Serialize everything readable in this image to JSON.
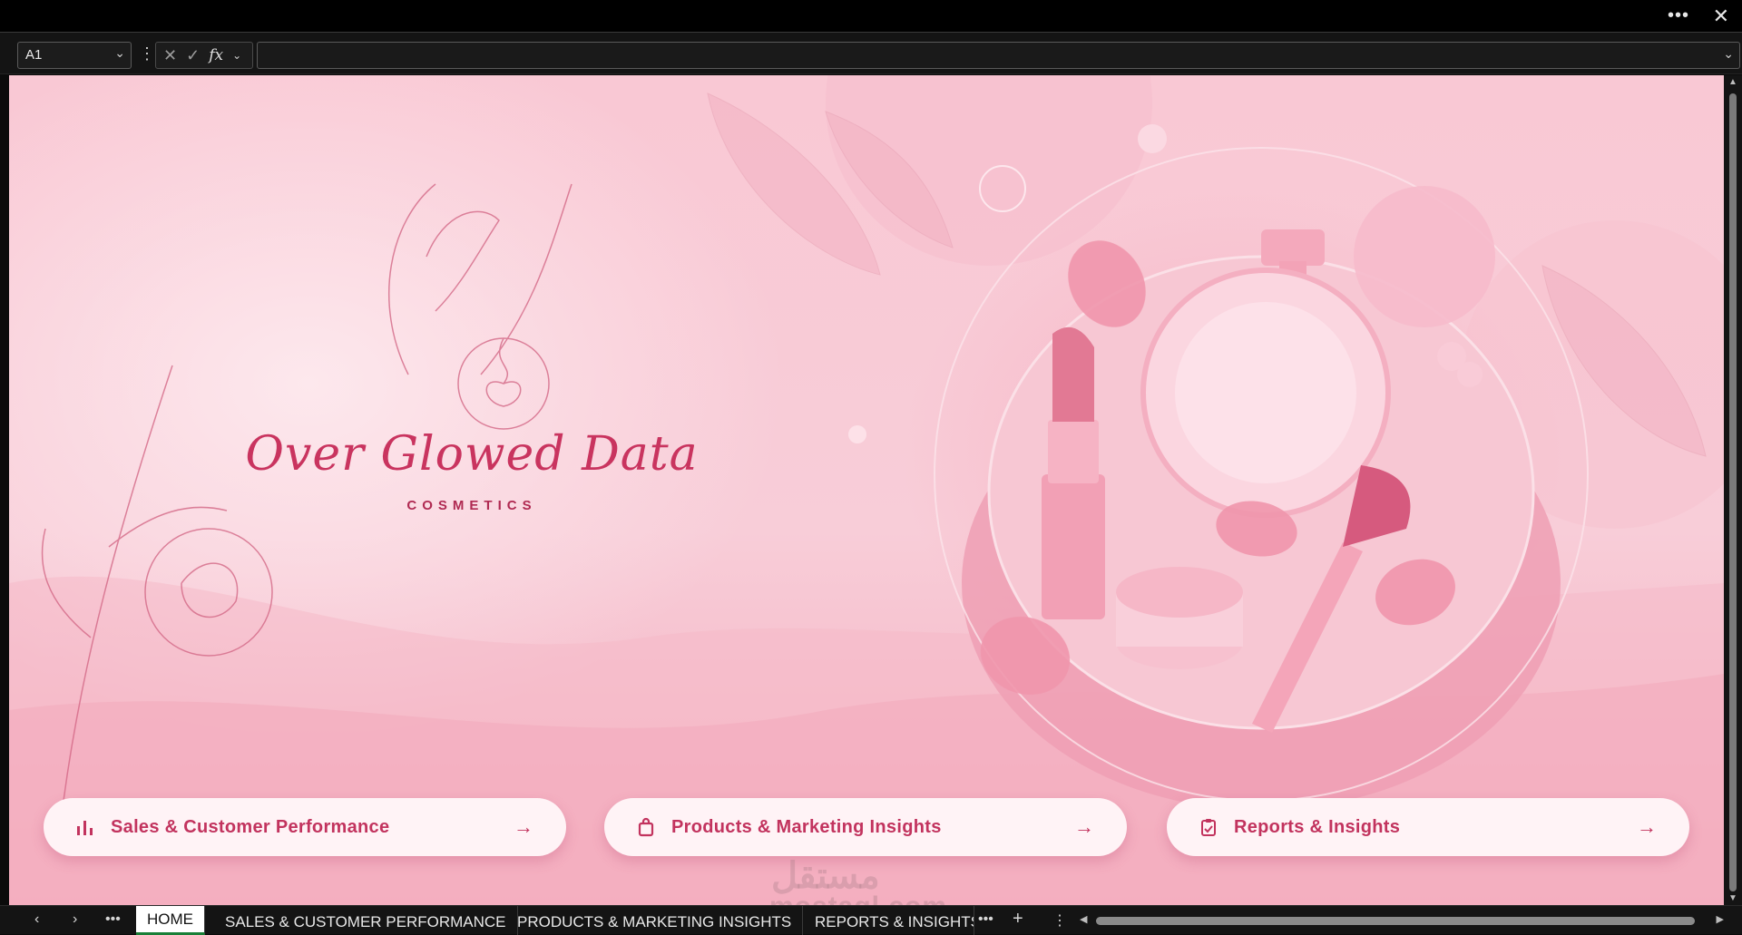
{
  "window": {
    "more_label": "•••",
    "close_label": "✕"
  },
  "formula_bar": {
    "name_box": "A1",
    "chevron": "⌄",
    "dots": "⋮",
    "cancel_icon": "✕",
    "enter_icon": "✓",
    "fx_label": "fx",
    "formula_value": ""
  },
  "dashboard": {
    "brand_name": "Over Glowed Data",
    "brand_subtitle": "COSMETICS",
    "buttons": [
      {
        "label": "Sales & Customer Performance",
        "icon": "bar-chart-icon",
        "arrow": "→"
      },
      {
        "label": "Products & Marketing Insights",
        "icon": "shopping-bag-icon",
        "arrow": "→"
      },
      {
        "label": "Reports & Insights",
        "icon": "clipboard-check-icon",
        "arrow": "→"
      }
    ],
    "watermark": "mostaql.com",
    "watermark_ar": "مستقل"
  },
  "tabs": {
    "prev": "‹",
    "next": "›",
    "more": "•••",
    "items": [
      {
        "label": "HOME",
        "active": true
      },
      {
        "label": "SALES & CUSTOMER PERFORMANCE",
        "active": false
      },
      {
        "label": "PRODUCTS & MARKETING INSIGHTS",
        "active": false
      },
      {
        "label": "REPORTS & INSIGHTS",
        "active": false
      }
    ],
    "add": "+",
    "options": "⋮"
  },
  "colors": {
    "accent": "#c2335e",
    "background_pink": "#f8cdd8",
    "button_bg": "#fff3f6"
  }
}
